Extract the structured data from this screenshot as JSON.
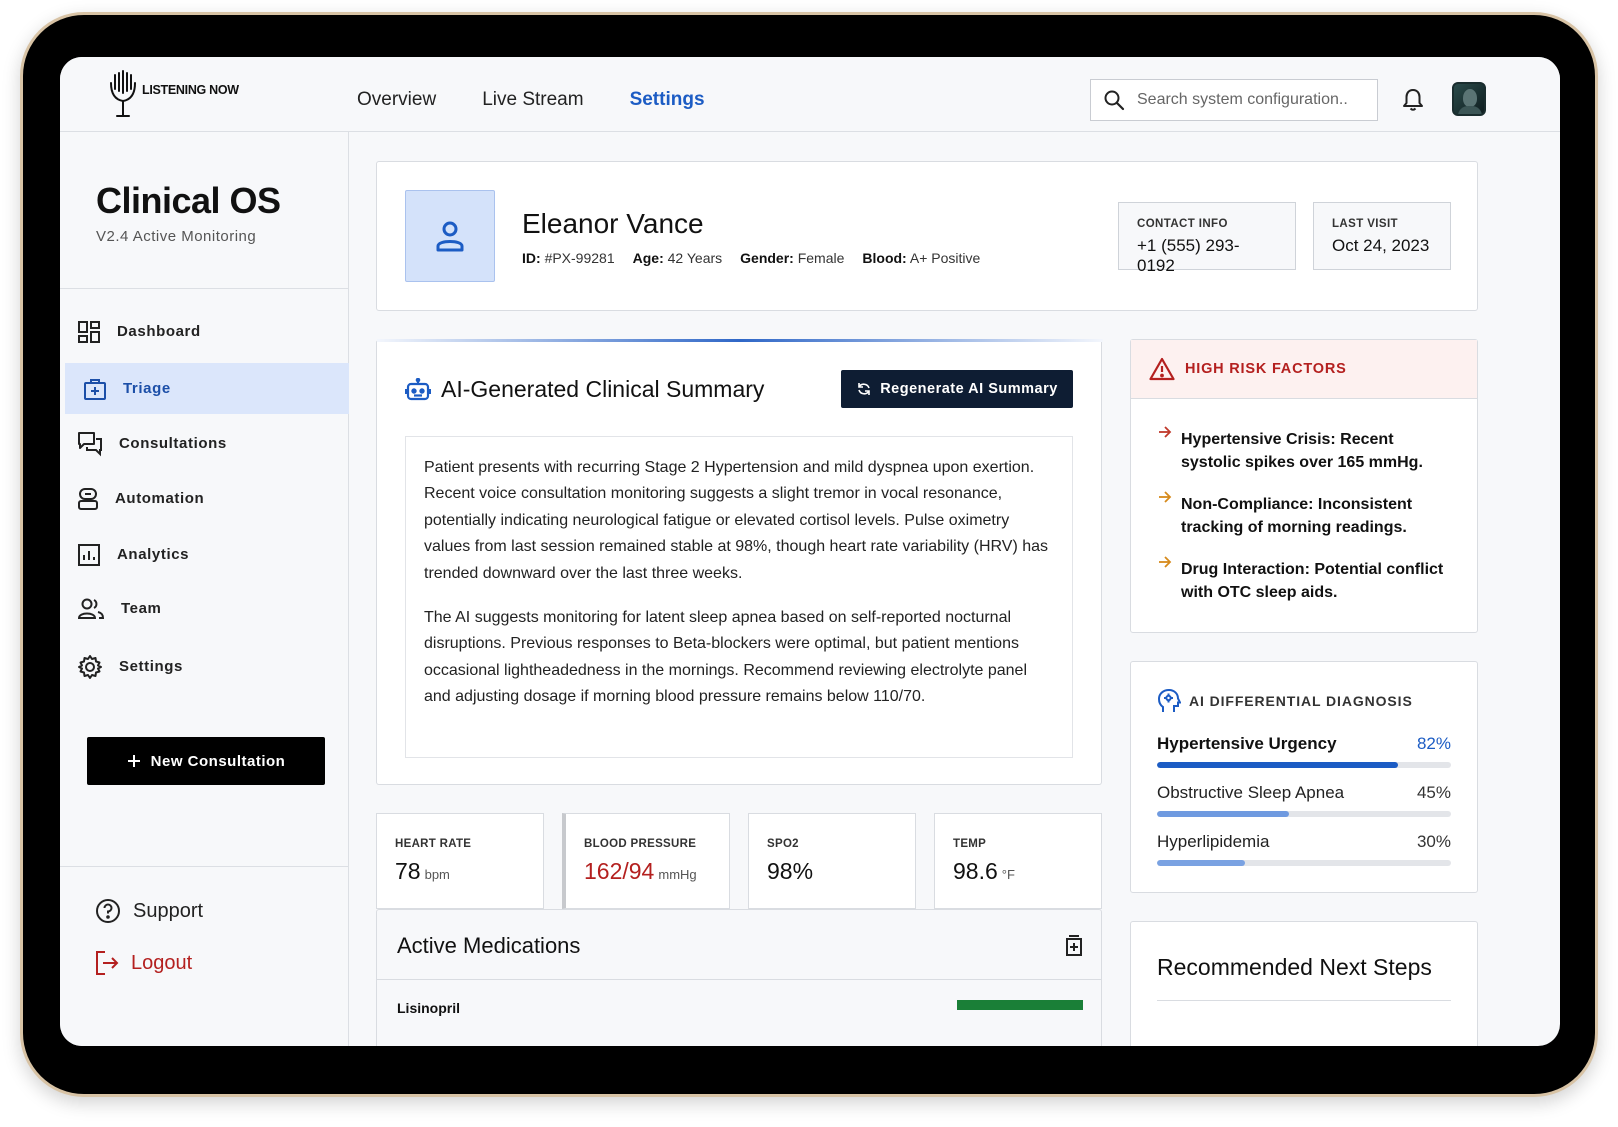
{
  "app": {
    "logo_text": "LISTENING NOW"
  },
  "nav": {
    "items": [
      {
        "label": "Overview",
        "active": false
      },
      {
        "label": "Live Stream",
        "active": false
      },
      {
        "label": "Settings",
        "active": true
      }
    ]
  },
  "search": {
    "placeholder": "Search system configuration..",
    "value": ""
  },
  "sidebar": {
    "title": "Clinical OS",
    "version": "V2.4 Active Monitoring",
    "items": [
      {
        "label": "Dashboard",
        "icon": "dashboard-icon",
        "active": false
      },
      {
        "label": "Triage",
        "icon": "medical-bag-icon",
        "active": true
      },
      {
        "label": "Consultations",
        "icon": "chat-icon",
        "active": false
      },
      {
        "label": "Automation",
        "icon": "robot-icon",
        "active": false
      },
      {
        "label": "Analytics",
        "icon": "chart-icon",
        "active": false
      },
      {
        "label": "Team",
        "icon": "team-icon",
        "active": false
      },
      {
        "label": "Settings",
        "icon": "gear-icon",
        "active": false
      }
    ],
    "new_consultation": "New Consultation",
    "support": "Support",
    "logout": "Logout"
  },
  "patient": {
    "name": "Eleanor Vance",
    "id_label": "ID:",
    "id": "#PX-99281",
    "age_label": "Age:",
    "age": "42 Years",
    "gender_label": "Gender:",
    "gender": "Female",
    "blood_label": "Blood:",
    "blood": "A+ Positive",
    "contact_label": "CONTACT INFO",
    "contact": "+1 (555) 293-0192",
    "last_visit_label": "LAST VISIT",
    "last_visit": "Oct 24, 2023"
  },
  "summary": {
    "title": "AI-Generated Clinical Summary",
    "regenerate": "Regenerate AI Summary",
    "paragraphs": [
      "Patient presents with recurring Stage 2 Hypertension and mild dyspnea upon exertion. Recent voice consultation monitoring suggests a slight tremor in vocal resonance, potentially indicating neurological fatigue or elevated cortisol levels. Pulse oximetry values from last session remained stable at 98%, though heart rate variability (HRV) has trended downward over the last three weeks.",
      "The AI suggests monitoring for latent sleep apnea based on self-reported nocturnal disruptions. Previous responses to Beta-blockers were optimal, but patient mentions occasional lightheadedness in the mornings. Recommend reviewing electrolyte panel and adjusting dosage if morning blood pressure remains below 110/70."
    ]
  },
  "vitals": [
    {
      "label": "HEART RATE",
      "value": "78",
      "unit": "bpm",
      "alert": false
    },
    {
      "label": "BLOOD PRESSURE",
      "value": "162/94",
      "unit": "mmHg",
      "alert": true
    },
    {
      "label": "SPO2",
      "value": "98%",
      "unit": "",
      "alert": false
    },
    {
      "label": "TEMP",
      "value": "98.6",
      "unit": "°F",
      "alert": false
    }
  ],
  "medications": {
    "title": "Active Medications",
    "rows": [
      {
        "name": "Lisinopril"
      }
    ]
  },
  "risk": {
    "title": "HIGH RISK FACTORS",
    "items": [
      "Hypertensive Crisis: Recent systolic spikes over 165 mmHg.",
      "Non-Compliance: Inconsistent tracking of morning readings.",
      "Drug Interaction: Potential conflict with OTC sleep aids."
    ]
  },
  "differential": {
    "title": "AI DIFFERENTIAL DIAGNOSIS",
    "items": [
      {
        "label": "Hypertensive Urgency",
        "pct": "82%",
        "value": 0.82,
        "color": "#1c5cc4"
      },
      {
        "label": "Obstructive Sleep Apnea",
        "pct": "45%",
        "value": 0.45,
        "color": "#6f9ae0"
      },
      {
        "label": "Hyperlipidemia",
        "pct": "30%",
        "value": 0.3,
        "color": "#7aa2e2"
      }
    ]
  },
  "next_steps": {
    "title": "Recommended Next Steps"
  },
  "colors": {
    "accent": "#1c5cc4",
    "alert": "#b4201f",
    "active_bg": "#dbe6fb"
  }
}
